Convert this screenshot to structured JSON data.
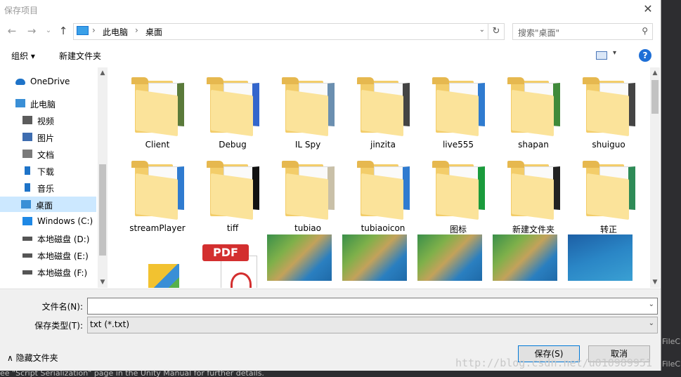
{
  "window": {
    "title": "保存项目",
    "close_glyph": "✕"
  },
  "nav": {
    "back_glyph": "←",
    "forward_glyph": "→",
    "recent_glyph": "⌄",
    "up_glyph": "↑",
    "breadcrumbs": [
      "此电脑",
      "桌面"
    ],
    "separator": "›",
    "dropdown_glyph": "⌄",
    "refresh_glyph": "↻",
    "search_placeholder": "搜索\"桌面\"",
    "search_glyph": "⚲"
  },
  "toolbar": {
    "organize_label": "组织 ▾",
    "new_folder_label": "新建文件夹",
    "help_glyph": "?",
    "view_dropdown_glyph": "▾"
  },
  "sidebar": {
    "items": [
      {
        "label": "OneDrive",
        "icon": "cloud-icon",
        "color": "#1e73c8"
      },
      {
        "label": "此电脑",
        "icon": "computer-icon",
        "color": "#3a8fd6"
      },
      {
        "label": "视频",
        "icon": "video-icon",
        "color": "#5c5c5c"
      },
      {
        "label": "图片",
        "icon": "picture-icon",
        "color": "#3e6db0"
      },
      {
        "label": "文档",
        "icon": "document-icon",
        "color": "#7a7a7a"
      },
      {
        "label": "下载",
        "icon": "download-icon",
        "color": "#1e73c8"
      },
      {
        "label": "音乐",
        "icon": "music-icon",
        "color": "#1e73c8"
      },
      {
        "label": "桌面",
        "icon": "desktop-icon",
        "color": "#3a8fd6",
        "selected": true
      },
      {
        "label": "Windows (C:)",
        "icon": "windows-drive-icon",
        "color": "#1e88e5"
      },
      {
        "label": "本地磁盘 (D:)",
        "icon": "drive-icon",
        "color": "#555555"
      },
      {
        "label": "本地磁盘 (E:)",
        "icon": "drive-icon",
        "color": "#555555"
      },
      {
        "label": "本地磁盘 (F:)",
        "icon": "drive-icon",
        "color": "#555555"
      }
    ]
  },
  "files": [
    {
      "name": "Client",
      "type": "folder",
      "overlay": "csharp-doc"
    },
    {
      "name": "Debug",
      "type": "folder",
      "overlay": "doc-globe"
    },
    {
      "name": "IL Spy",
      "type": "folder",
      "overlay": "monitor"
    },
    {
      "name": "jinzita",
      "type": "folder",
      "overlay": "unity-ball"
    },
    {
      "name": "live555",
      "type": "folder",
      "overlay": "winrar"
    },
    {
      "name": "shapan",
      "type": "folder",
      "overlay": "unity-green"
    },
    {
      "name": "shuiguo",
      "type": "folder",
      "overlay": "unity-ball"
    },
    {
      "name": "streamPlayer",
      "type": "folder",
      "overlay": "winrar"
    },
    {
      "name": "tiff",
      "type": "folder",
      "overlay": "black"
    },
    {
      "name": "tubiao",
      "type": "folder",
      "overlay": "map-red"
    },
    {
      "name": "tubiaoicon",
      "type": "folder",
      "overlay": "winrar-blue"
    },
    {
      "name": "图标",
      "type": "folder",
      "overlay": "black-green"
    },
    {
      "name": "新建文件夹",
      "type": "folder",
      "overlay": "unity"
    },
    {
      "name": "转正",
      "type": "folder",
      "overlay": "excel-ball"
    },
    {
      "name": "",
      "type": "cube"
    },
    {
      "name": "",
      "type": "pdf",
      "badge": "PDF"
    },
    {
      "name": "",
      "type": "terrain"
    },
    {
      "name": "",
      "type": "terrain"
    },
    {
      "name": "",
      "type": "terrain"
    },
    {
      "name": "",
      "type": "terrain"
    },
    {
      "name": "",
      "type": "terrain-blue"
    }
  ],
  "fields": {
    "filename_label": "文件名(N):",
    "filename_value": "",
    "filetype_label": "保存类型(T):",
    "filetype_value": "txt (*.txt)",
    "dropdown_glyph": "⌄"
  },
  "footer": {
    "hide_folders_label": "∧  隐藏文件夹",
    "save_label": "保存(S)",
    "cancel_label": "取消"
  },
  "background": {
    "right_text_1": "FileC",
    "right_text_2": "FileC",
    "bottom_text": "ee \"Script Serialization\" page in the Unity Manual for further details."
  },
  "watermark": "http://blog.csdn.net/u010989951"
}
